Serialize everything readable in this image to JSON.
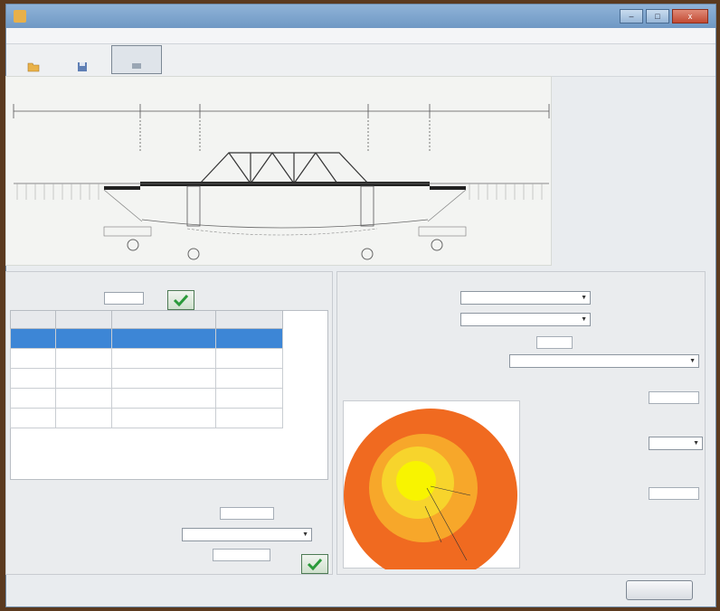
{
  "window": {
    "title": "",
    "minimize": "–",
    "maximize": "□",
    "close": "x"
  },
  "menu": [
    "",
    ""
  ],
  "toolbar": {
    "buttons": [
      {
        "label": "",
        "icon": "folder-icon"
      },
      {
        "label": "",
        "icon": "save-icon"
      },
      {
        "label": "",
        "icon": "run-icon"
      }
    ]
  },
  "diagram": {
    "title": "",
    "left_label": "",
    "right_label": "",
    "span_labels": [
      "",
      "",
      ""
    ],
    "span_dims": [
      "",
      "",
      ""
    ],
    "level_right": "",
    "water_levels": [
      "",
      ""
    ],
    "pier_numbers": [
      "",
      "",
      "",
      ""
    ]
  },
  "spans_panel": {
    "title": "",
    "count_label": "",
    "count_value": "",
    "columns": [
      "",
      "",
      "",
      ""
    ],
    "rows": [
      [
        "",
        "",
        "",
        ""
      ],
      [
        "",
        "",
        "",
        ""
      ],
      [
        "",
        "",
        "",
        ""
      ],
      [
        "",
        "",
        "",
        ""
      ],
      [
        "",
        "",
        "",
        ""
      ]
    ],
    "selected_row": 0
  },
  "bottom_group": {
    "label": "",
    "fields": [
      {
        "label": "",
        "value": ""
      },
      {
        "label": "",
        "value": ""
      },
      {
        "label": "",
        "value": ""
      }
    ]
  },
  "right_panel": {
    "header": "",
    "combo1_label": "",
    "combo1_value": "",
    "combo2_label": "",
    "combo2_value": "",
    "mass_label": "",
    "mass_value": "",
    "place_label": "",
    "place_value": "",
    "chart_caption": "",
    "result1_label": "",
    "result1_value": "",
    "result2_label": "",
    "result2_value": "",
    "result3_label": "",
    "result3_value": ""
  },
  "colors": {
    "outer_ring": "#f06a20",
    "mid_ring": "#f7a72a",
    "inner_ring": "#f7d42c",
    "core": "#f8f400",
    "selection": "#3d86d6",
    "ok_green": "#2a9a3a"
  },
  "footer": {
    "exit_label": ""
  }
}
